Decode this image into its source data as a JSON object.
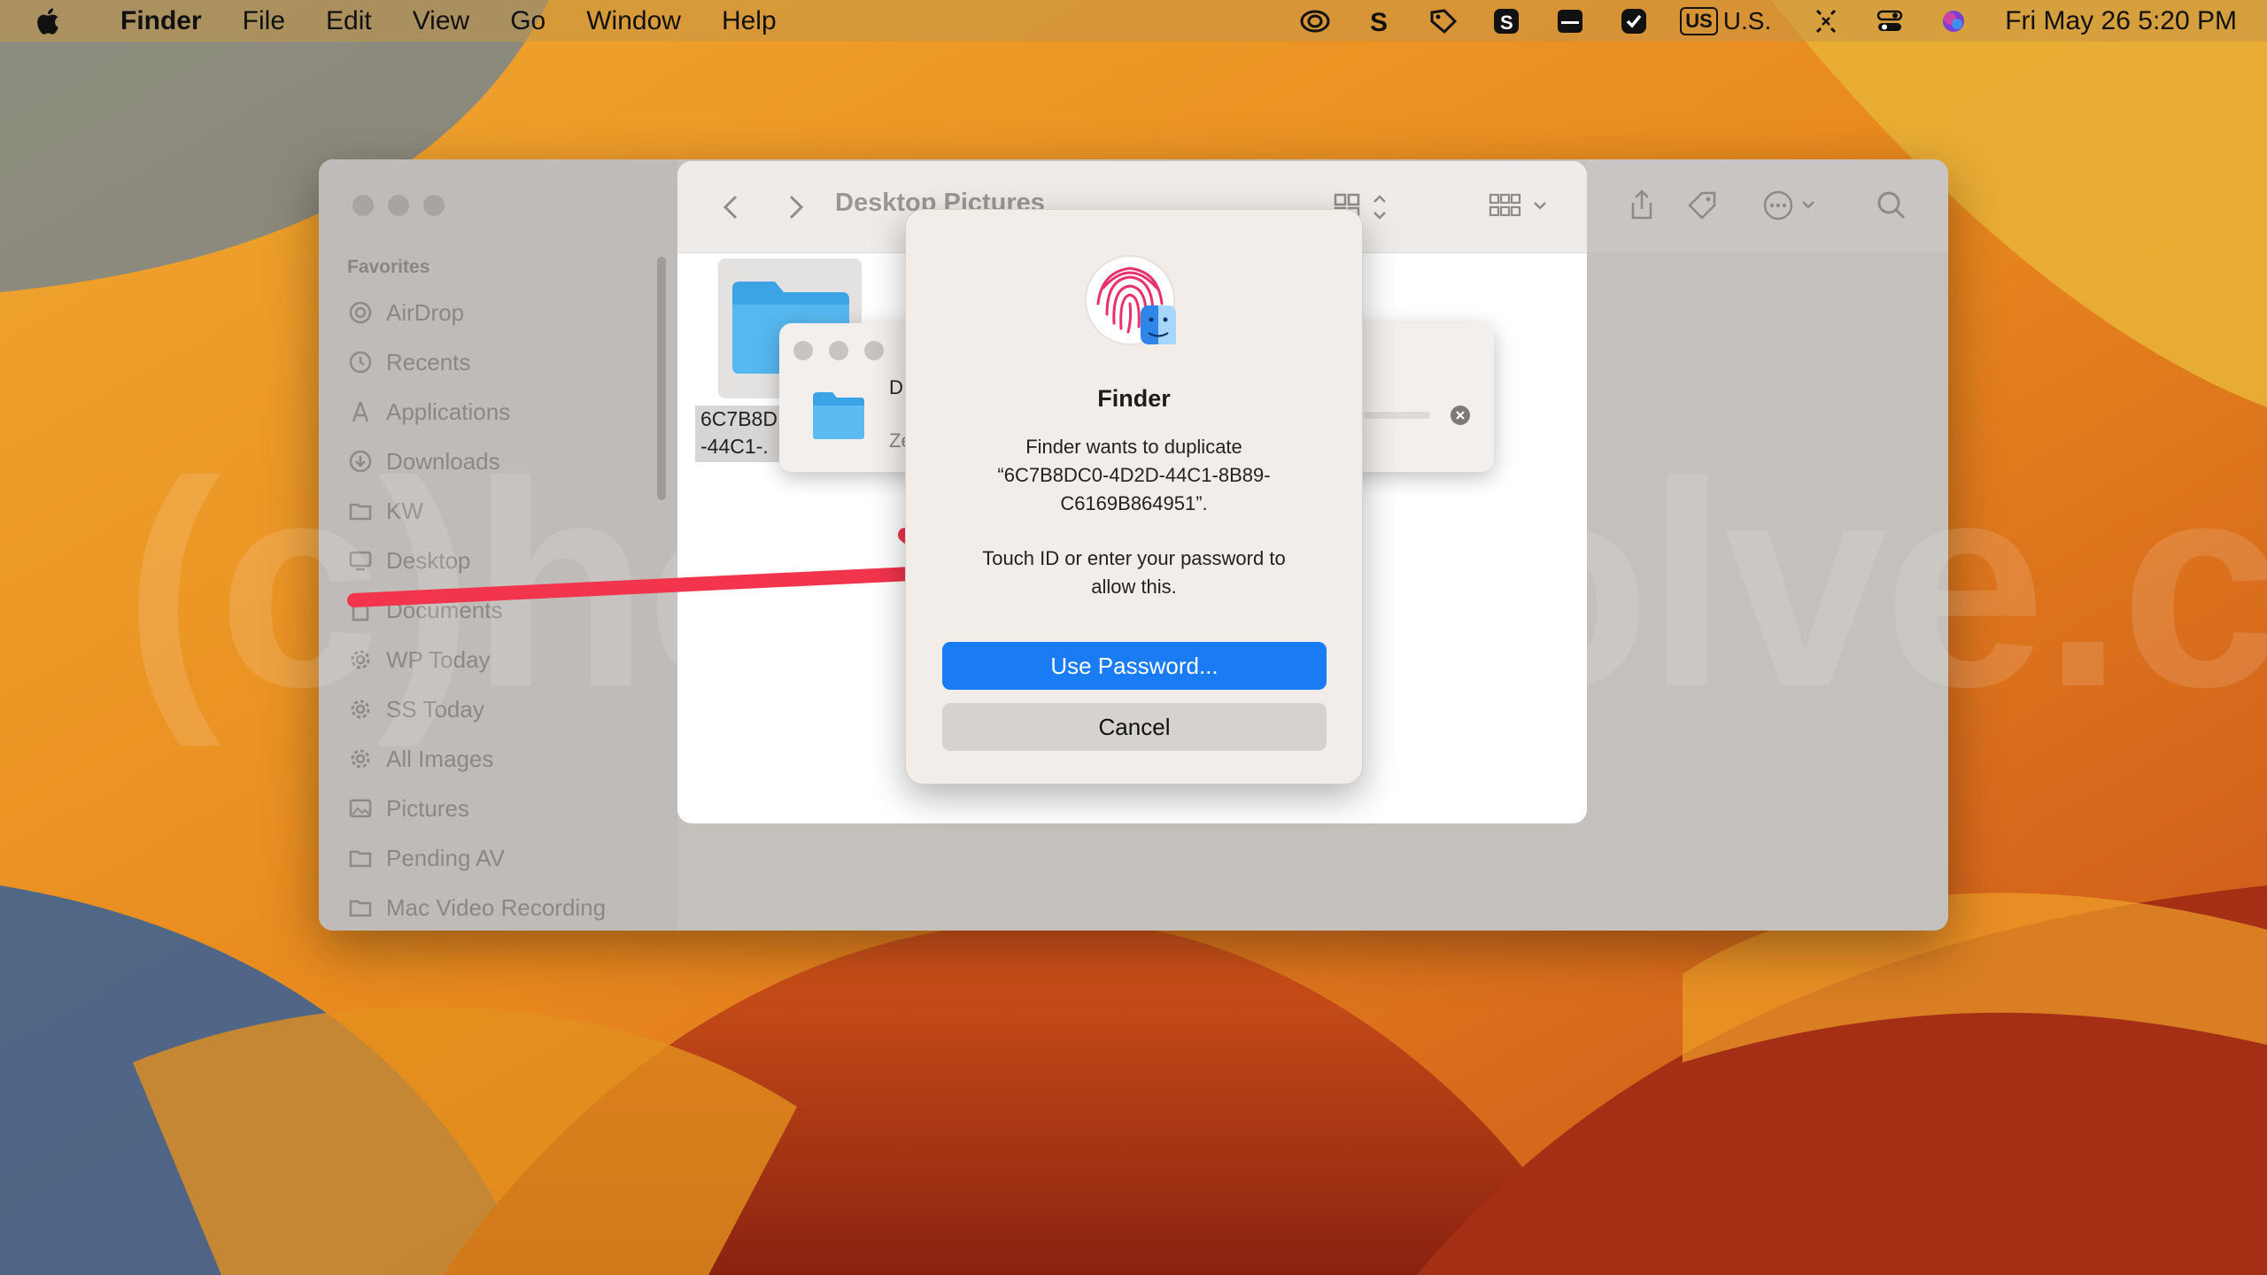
{
  "menubar": {
    "app": "Finder",
    "items": [
      "File",
      "Edit",
      "View",
      "Go",
      "Window",
      "Help"
    ],
    "keyboard_badge": "US",
    "keyboard_label": "U.S.",
    "clock": "Fri May 26  5:20 PM"
  },
  "sidebar": {
    "heading": "Favorites",
    "items": [
      {
        "label": "AirDrop",
        "icon": "airdrop-icon"
      },
      {
        "label": "Recents",
        "icon": "clock-icon"
      },
      {
        "label": "Applications",
        "icon": "applications-icon"
      },
      {
        "label": "Downloads",
        "icon": "download-icon"
      },
      {
        "label": "KW",
        "icon": "folder-icon"
      },
      {
        "label": "Desktop",
        "icon": "desktop-icon"
      },
      {
        "label": "Documents",
        "icon": "document-icon"
      },
      {
        "label": "WP Today",
        "icon": "gear-icon"
      },
      {
        "label": "SS Today",
        "icon": "gear-icon"
      },
      {
        "label": "All Images",
        "icon": "gear-icon"
      },
      {
        "label": "Pictures",
        "icon": "pictures-icon"
      },
      {
        "label": "Pending AV",
        "icon": "folder-icon"
      },
      {
        "label": "Mac Video Recording",
        "icon": "folder-icon"
      }
    ]
  },
  "browser": {
    "title": "Desktop Pictures",
    "file_label_line1": "6C7B8D",
    "file_label_line2": "-44C1-."
  },
  "progress": {
    "name": "D",
    "status": "Ze"
  },
  "dialog": {
    "title": "Finder",
    "message_line1": "Finder wants to duplicate",
    "message_line2": "“6C7B8DC0-4D2D-44C1-8B89-",
    "message_line3": "C6169B864951”.",
    "prompt_line1": "Touch ID or enter your password to",
    "prompt_line2": "allow this.",
    "primary_button": "Use Password...",
    "cancel_button": "Cancel"
  },
  "watermark": "(c)howtosolve.com",
  "colors": {
    "accent": "#1a7cf5",
    "arrow": "#f2344c"
  }
}
